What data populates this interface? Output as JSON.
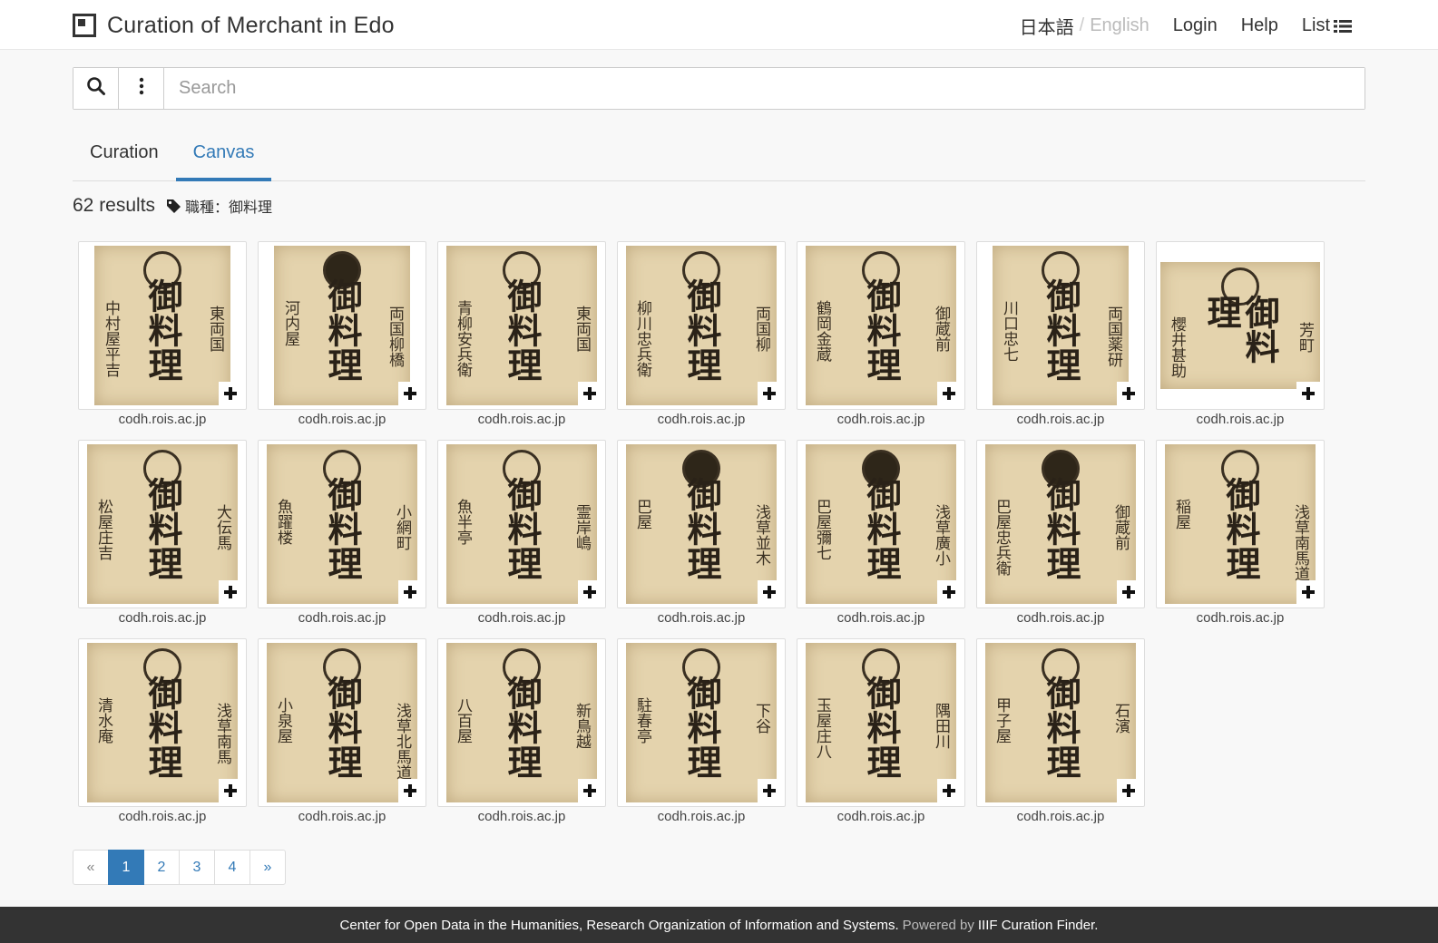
{
  "header": {
    "title": "Curation of Merchant in Edo",
    "lang_ja": "日本語",
    "lang_sep": "/",
    "lang_en": "English",
    "login": "Login",
    "help": "Help",
    "list": "List"
  },
  "search": {
    "placeholder": "Search"
  },
  "tabs": [
    {
      "label": "Curation"
    },
    {
      "label": "Canvas"
    }
  ],
  "results": {
    "count_text": "62 results",
    "facet": "職種：御料理"
  },
  "items": [
    {
      "source": "codh.rois.ac.jp",
      "main": "御料理",
      "left": "中村屋平吉",
      "right": "東両国"
    },
    {
      "source": "codh.rois.ac.jp",
      "main": "御料理",
      "left": "河内屋",
      "right": "両国柳橋"
    },
    {
      "source": "codh.rois.ac.jp",
      "main": "御料理",
      "left": "青柳安兵衛",
      "right": "東両国"
    },
    {
      "source": "codh.rois.ac.jp",
      "main": "御料理",
      "left": "柳川忠兵衛",
      "right": "両国柳"
    },
    {
      "source": "codh.rois.ac.jp",
      "main": "御料理",
      "left": "鶴岡金蔵",
      "right": "御蔵前"
    },
    {
      "source": "codh.rois.ac.jp",
      "main": "御料理",
      "left": "川口忠七",
      "right": "両国薬研"
    },
    {
      "source": "codh.rois.ac.jp",
      "main": "御料理",
      "left": "櫻井甚助",
      "right": "芳町"
    },
    {
      "source": "codh.rois.ac.jp",
      "main": "御料理",
      "left": "松屋庄吉",
      "right": "大伝馬"
    },
    {
      "source": "codh.rois.ac.jp",
      "main": "御料理",
      "left": "魚躍楼",
      "right": "小網町"
    },
    {
      "source": "codh.rois.ac.jp",
      "main": "御料理",
      "left": "魚半亭",
      "right": "霊岸嶋"
    },
    {
      "source": "codh.rois.ac.jp",
      "main": "御料理",
      "left": "巴屋",
      "right": "浅草並木"
    },
    {
      "source": "codh.rois.ac.jp",
      "main": "御料理",
      "left": "巴屋彌七",
      "right": "浅草廣小"
    },
    {
      "source": "codh.rois.ac.jp",
      "main": "御料理",
      "left": "巴屋忠兵衛",
      "right": "御蔵前"
    },
    {
      "source": "codh.rois.ac.jp",
      "main": "御料理",
      "left": "稲屋",
      "right": "浅草南馬道"
    },
    {
      "source": "codh.rois.ac.jp",
      "main": "御料理",
      "left": "清水庵",
      "right": "浅草南馬"
    },
    {
      "source": "codh.rois.ac.jp",
      "main": "御料理",
      "left": "小泉屋",
      "right": "浅草北馬道"
    },
    {
      "source": "codh.rois.ac.jp",
      "main": "御料理",
      "left": "八百屋",
      "right": "新鳥越"
    },
    {
      "source": "codh.rois.ac.jp",
      "main": "御料理",
      "left": "駐春亭",
      "right": "下谷"
    },
    {
      "source": "codh.rois.ac.jp",
      "main": "御料理",
      "left": "玉屋庄八",
      "right": "隅田川"
    },
    {
      "source": "codh.rois.ac.jp",
      "main": "御料理",
      "left": "甲子屋",
      "right": "石濱"
    }
  ],
  "pagination": {
    "prev": "«",
    "pages": [
      "1",
      "2",
      "3",
      "4"
    ],
    "next": "»",
    "active": "1"
  },
  "footer": {
    "org": "Center for Open Data in the Humanities, Research Organization of Information and Systems.",
    "powered": "Powered by",
    "finder": "IIIF Curation Finder."
  }
}
